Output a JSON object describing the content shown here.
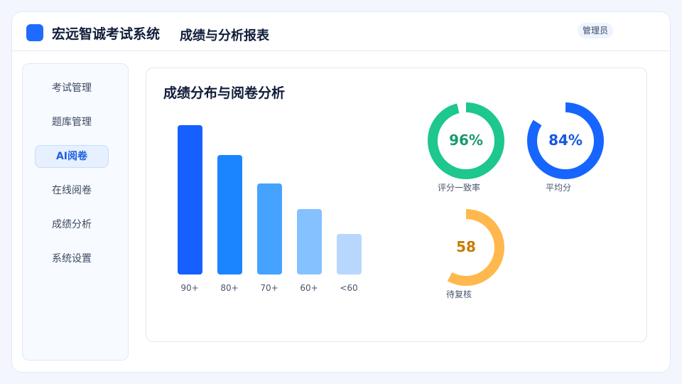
{
  "header": {
    "app_title": "宏远智诚考试系统",
    "page_title": "成绩与分析报表",
    "user_role": "管理员"
  },
  "sidebar": {
    "items": [
      {
        "label": "考试管理",
        "active": false
      },
      {
        "label": "题库管理",
        "active": false
      },
      {
        "label": "AI阅卷",
        "active": true
      },
      {
        "label": "在线阅卷",
        "active": false
      },
      {
        "label": "成绩分析",
        "active": false
      },
      {
        "label": "系统设置",
        "active": false
      }
    ]
  },
  "panel": {
    "title": "成绩分布与阅卷分析"
  },
  "chart_data": [
    {
      "type": "bar",
      "categories": [
        "90+",
        "80+",
        "70+",
        "60+",
        "<60"
      ],
      "values": [
        100,
        80,
        61,
        44,
        27
      ],
      "colors": [
        "#1560ff",
        "#1a85ff",
        "#45a3ff",
        "#86c1ff",
        "#b7d7ff"
      ],
      "ylim": [
        0,
        100
      ]
    },
    {
      "type": "pie",
      "rings": [
        {
          "value_text": "96%",
          "label": "评分一致率",
          "fraction": 0.96,
          "color": "#1dc78d",
          "text_color": "#1a9a6c"
        },
        {
          "value_text": "84%",
          "label": "平均分",
          "fraction": 0.84,
          "color": "#1665ff",
          "text_color": "#1657e0"
        },
        {
          "value_text": "58",
          "label": "待复核",
          "fraction": 0.58,
          "color": "#ffb84d",
          "text_color": "#c77c00"
        }
      ]
    }
  ]
}
